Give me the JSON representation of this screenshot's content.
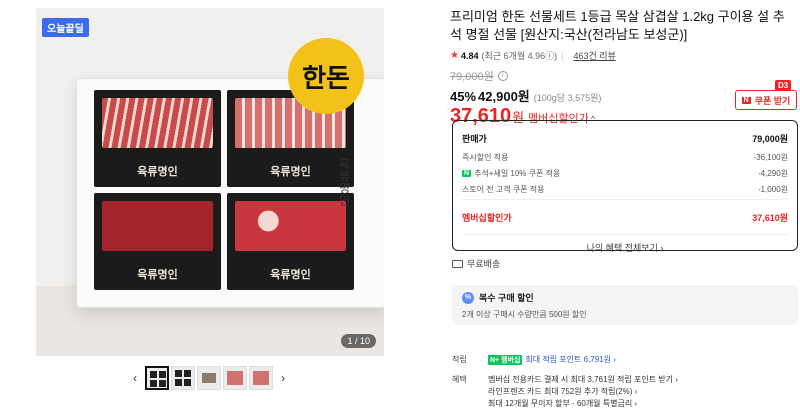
{
  "gallery": {
    "badge": "오늘끝딜",
    "logo_text": "한돈",
    "side_text": "육류명인",
    "pack_label": "육류명인",
    "counter": "1 / 10",
    "prev_icon": "‹",
    "next_icon": "›",
    "thumb_count": 5
  },
  "product": {
    "title": "프리미엄 한돈 선물세트 1등급 목살 삼겹살 1.2kg 구이용 설 추석 명절 선물 [원산지:국산(전라남도 보성군)]",
    "rating": "4.84",
    "rating_note": "(최근 6개월 4.96ⓘ)",
    "review_link": "463건 리뷰",
    "original_price": "79,000원",
    "discount": "45%",
    "sale_price": "42,900원",
    "unit_price": "(100g당 3,575원)",
    "member_price": "37,610",
    "member_won": "원",
    "member_label": "멤버십할인가"
  },
  "coupon": {
    "badge": "D3",
    "n_mark": "N",
    "label": "쿠폰 받기"
  },
  "price_breakdown": {
    "head_label": "판매가",
    "head_value": "79,000원",
    "rows": [
      {
        "label": "즉시할인 적용",
        "value": "-36,100원"
      },
      {
        "label": "추석+세일 10% 쿠폰 적용",
        "value": "-4,290원"
      },
      {
        "label": "스토어 전 고객 쿠폰 적용",
        "value": "-1,000원"
      }
    ],
    "npay_mark": "N",
    "total_label": "멤버십할인가",
    "total_value": "37,610원",
    "benefit_link": "나의 혜택 전체보기 ›"
  },
  "shipping": {
    "label": "무료배송"
  },
  "multi_discount": {
    "icon": "%",
    "title": "복수 구매 할인",
    "desc": "2개 이상 구매시 수량만큼 500원 할인"
  },
  "earn": {
    "label": "적립",
    "badge": "N+ 멤버십",
    "text": "최대 적립 포인트 6,791원 ›"
  },
  "benefits": {
    "label": "혜택",
    "lines": [
      "멤버십 전용카드 결제 시 최대 3,761원 적립 포인트 받기 ›",
      "라인프렌즈 카드 최대 752원 추가 적립(2%) ›",
      "최대 12개월 무이자 할부 · 60개월 특별금리 ›"
    ]
  }
}
